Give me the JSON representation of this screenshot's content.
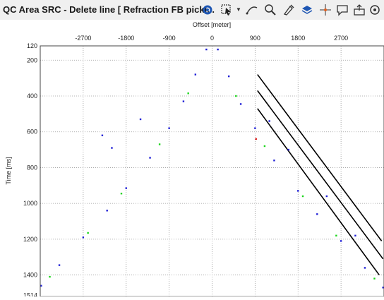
{
  "window": {
    "title": "QC Area SRC - Delete line [ Refraction FB picki..."
  },
  "toolbar": {
    "icons": [
      "gear-icon",
      "select-arrow-icon",
      "chevron-down-icon",
      "draw-line-icon",
      "zoom-icon",
      "paint-icon",
      "layers-icon",
      "crosshair-icon",
      "comment-icon",
      "export-icon",
      "settings-icon",
      "more-icon"
    ]
  },
  "colors": {
    "points_primary": "#1f1fd6",
    "points_secondary": "#1bd61b",
    "points_highlight": "#e02020",
    "lines": "#000000",
    "grid": "#9a9a9a"
  },
  "chart_data": {
    "type": "scatter",
    "title": "",
    "xlabel": "Offset [meter]",
    "ylabel": "Time [ms]",
    "xlim": [
      -3600,
      3600
    ],
    "ylim": [
      1520,
      120
    ],
    "x_ticks": [
      -2700,
      -1800,
      -900,
      0,
      900,
      1800,
      2700
    ],
    "y_ticks": [
      120,
      200,
      400,
      600,
      800,
      1000,
      1200,
      1400,
      1514
    ],
    "x_tick_labels": [
      "-2700",
      "-1800",
      "-900",
      "0",
      "900",
      "1800",
      "2700"
    ],
    "y_tick_labels": [
      "120",
      "200",
      "400",
      "600",
      "800",
      "1000",
      "1200",
      "1400",
      "1514"
    ],
    "grid": true,
    "series": [
      {
        "points": [
          {
            "x": -3580,
            "y": 1460
          },
          {
            "x": -3200,
            "y": 1345
          },
          {
            "x": -2700,
            "y": 1190
          },
          {
            "x": -2200,
            "y": 1040
          },
          {
            "x": -1800,
            "y": 915
          },
          {
            "x": -1300,
            "y": 745
          },
          {
            "x": -900,
            "y": 580
          },
          {
            "x": -600,
            "y": 430
          },
          {
            "x": -350,
            "y": 280
          },
          {
            "x": -120,
            "y": 140
          },
          {
            "x": 120,
            "y": 140
          },
          {
            "x": 350,
            "y": 290
          },
          {
            "x": 600,
            "y": 445
          },
          {
            "x": 900,
            "y": 580
          },
          {
            "x": 1300,
            "y": 760
          },
          {
            "x": 1800,
            "y": 930
          },
          {
            "x": 2200,
            "y": 1060
          },
          {
            "x": 2700,
            "y": 1210
          },
          {
            "x": 3200,
            "y": 1360
          },
          {
            "x": 3580,
            "y": 1470
          },
          {
            "x": -2300,
            "y": 620
          },
          {
            "x": -2100,
            "y": 690
          },
          {
            "x": -1500,
            "y": 530
          },
          {
            "x": 1200,
            "y": 540
          },
          {
            "x": 1600,
            "y": 700
          },
          {
            "x": 2400,
            "y": 960
          },
          {
            "x": 3000,
            "y": 1180
          }
        ]
      },
      {
        "points": [
          {
            "x": -3400,
            "y": 1410
          },
          {
            "x": -2600,
            "y": 1165
          },
          {
            "x": -1900,
            "y": 945
          },
          {
            "x": -1100,
            "y": 670
          },
          {
            "x": -500,
            "y": 385
          },
          {
            "x": 500,
            "y": 400
          },
          {
            "x": 1100,
            "y": 680
          },
          {
            "x": 1900,
            "y": 960
          },
          {
            "x": 2600,
            "y": 1180
          },
          {
            "x": 3400,
            "y": 1420
          }
        ]
      },
      {
        "points": [
          {
            "x": 920,
            "y": 640
          }
        ]
      }
    ],
    "lines": [
      {
        "x1": 950,
        "y1": 280,
        "x2": 3550,
        "y2": 1210
      },
      {
        "x1": 950,
        "y1": 370,
        "x2": 3580,
        "y2": 1310
      },
      {
        "x1": 950,
        "y1": 470,
        "x2": 3500,
        "y2": 1400
      }
    ]
  }
}
